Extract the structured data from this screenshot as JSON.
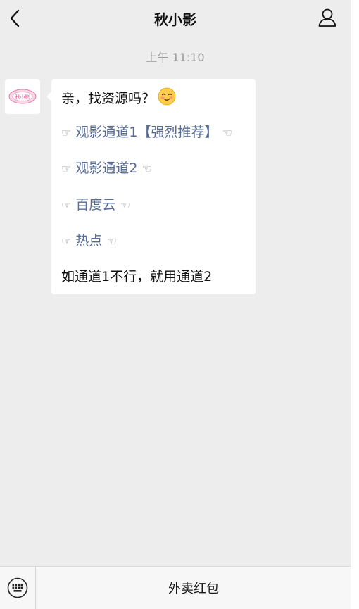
{
  "navbar": {
    "title": "秋小影",
    "back_icon": "chevron-left-icon",
    "contact_icon": "user-profile-icon"
  },
  "chat": {
    "timestamp": "上午 11:10",
    "avatar_brand": "秋小影",
    "message": {
      "greeting": "亲，找资源吗？",
      "greeting_emoji": "smiling-face-emoji",
      "hand_left": "☞",
      "hand_right": "☜",
      "links": [
        "观影通道1【强烈推荐】",
        "观影通道2",
        "百度云",
        "热点"
      ],
      "footer": "如通道1不行，就用通道2"
    }
  },
  "bottom_bar": {
    "keyboard_icon": "keyboard-icon",
    "menu_label": "外卖红包"
  },
  "colors": {
    "background": "#ededed",
    "bubble": "#ffffff",
    "link": "#576b95",
    "timestamp": "#9b9b9b"
  }
}
